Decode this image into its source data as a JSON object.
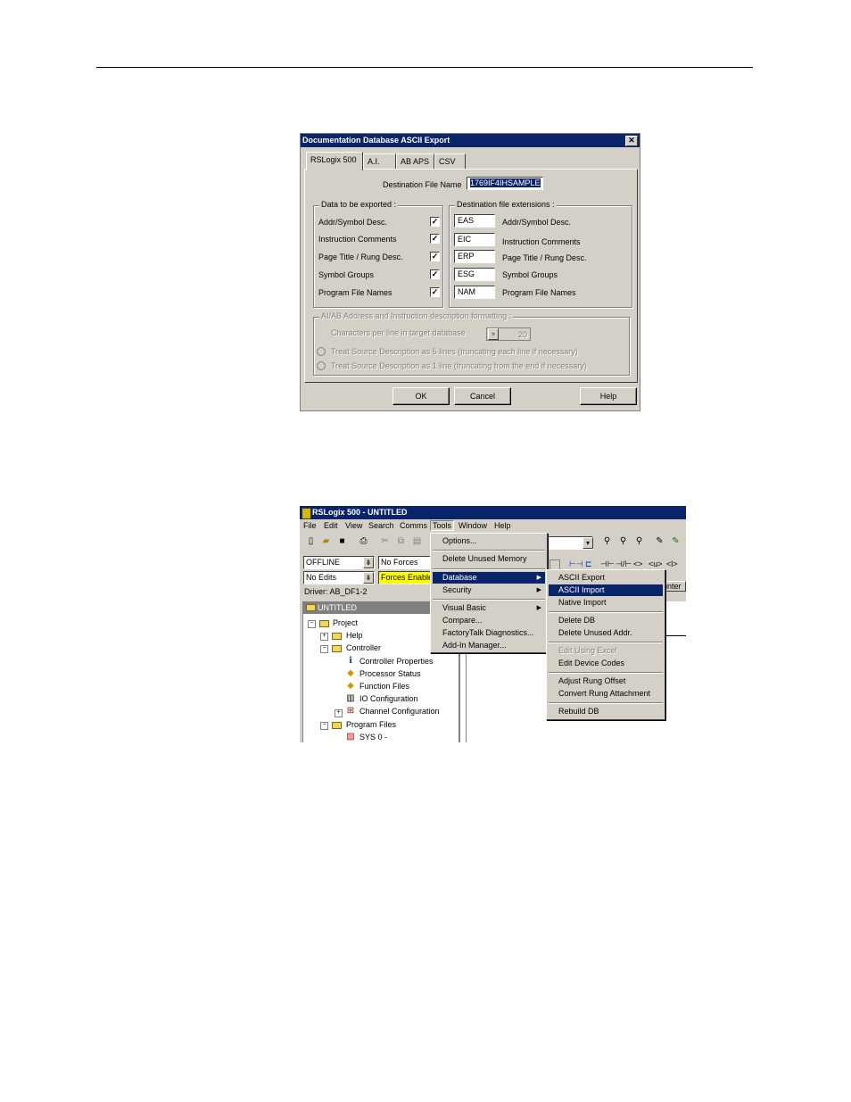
{
  "dialog": {
    "title": "Documentation Database ASCII Export",
    "close_glyph": "✕",
    "tabs": [
      "RSLogix 500",
      "A.I.",
      "AB APS",
      "CSV"
    ],
    "destination_label": "Destination File Name",
    "destination_value": "1769IF4IHSAMPLE",
    "data_group_title": "Data to be exported :",
    "data_items": [
      {
        "label": "Addr/Symbol Desc.",
        "checked": "✓"
      },
      {
        "label": "Instruction Comments",
        "checked": "✓"
      },
      {
        "label": "Page Title / Rung Desc.",
        "checked": "✓"
      },
      {
        "label": "Symbol Groups",
        "checked": "✓"
      },
      {
        "label": "Program File Names",
        "checked": "✓"
      }
    ],
    "ext_group_title": "Destination file extensions :",
    "extensions": [
      {
        "ext": "EAS",
        "label": "Addr/Symbol Desc."
      },
      {
        "ext": "EIC",
        "label": "Instruction Comments"
      },
      {
        "ext": "ERP",
        "label": "Page Title / Rung Desc."
      },
      {
        "ext": "ESG",
        "label": "Symbol Groups"
      },
      {
        "ext": "NAM",
        "label": "Program File Names"
      }
    ],
    "ai_group_title": "AI/AB Address and Instruction description formatting :",
    "chars_label": "Characters per line in target database",
    "chars_value": "20",
    "radio1": "Treat Source Description as 5 lines (truncating each line if necessary)",
    "radio2": "Treat Source Description as 1 line (truncating from the end if necessary)",
    "ok": "OK",
    "cancel": "Cancel",
    "help": "Help"
  },
  "app": {
    "title": "RSLogix 500 - UNTITLED",
    "menu": [
      "File",
      "Edit",
      "View",
      "Search",
      "Comms",
      "Tools",
      "Window",
      "Help"
    ],
    "mode_value": "OFFLINE",
    "edits_value": "No Edits",
    "forces_value": "No Forces",
    "forces_enabled": "Forces Enable",
    "driver": "Driver: AB_DF1-2",
    "partial_tab": "unter",
    "project_title": "UNTITLED",
    "tree": [
      {
        "label": "Project"
      },
      {
        "label": "Help"
      },
      {
        "label": "Controller"
      },
      {
        "label": "Controller Properties"
      },
      {
        "label": "Processor Status"
      },
      {
        "label": "Function Files"
      },
      {
        "label": "IO Configuration"
      },
      {
        "label": "Channel Configuration"
      },
      {
        "label": "Program Files"
      },
      {
        "label": "SYS 0 -"
      }
    ],
    "tools_menu": [
      "Options...",
      "Delete Unused Memory",
      "Database",
      "Security",
      "Visual Basic",
      "Compare...",
      "FactoryTalk Diagnostics...",
      "Add-In Manager..."
    ],
    "database_menu": [
      "ASCII Export",
      "ASCII Import",
      "Native Import",
      "Delete DB",
      "Delete Unused Addr.",
      "Edit Using Excel",
      "Edit Device Codes",
      "Adjust Rung Offset",
      "Convert Rung Attachment",
      "Rebuild DB"
    ],
    "toolbar_symbols": [
      "⊣⊢",
      "⊣/⊢",
      "<>",
      "<u>",
      "<l>"
    ]
  }
}
